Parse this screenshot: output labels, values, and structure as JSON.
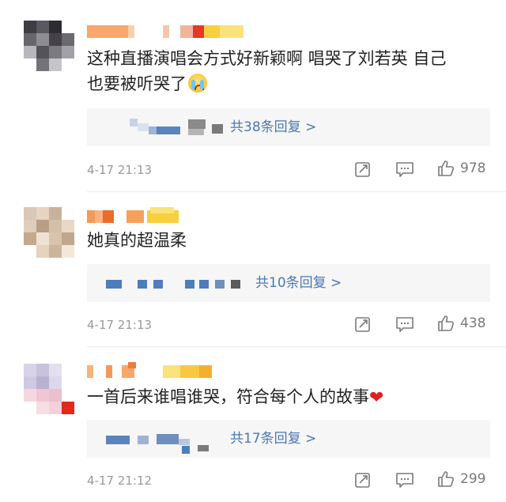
{
  "comments": [
    {
      "text": "这种直播演唱会方式好新颖啊 唱哭了刘若英 自己",
      "text2": "也要被听哭了",
      "emoji": "crying-face",
      "reply": "共38条回复 >",
      "time": "4-17 21:13",
      "likes": "978"
    },
    {
      "text": "她真的超温柔",
      "reply": "共10条回复 >",
      "time": "4-17 21:13",
      "likes": "438"
    },
    {
      "text": "一首后来谁唱谁哭，符合每个人的故事",
      "emoji": "red-heart",
      "heart": "❤",
      "reply": "共17条回复 >",
      "time": "4-17 21:12",
      "likes": "299"
    }
  ],
  "colors": {
    "link": "#4a78b4",
    "text": "#222222",
    "meta": "#9a9a9a",
    "reply_bg": "#f6f6f6",
    "heart": "#e02020"
  }
}
